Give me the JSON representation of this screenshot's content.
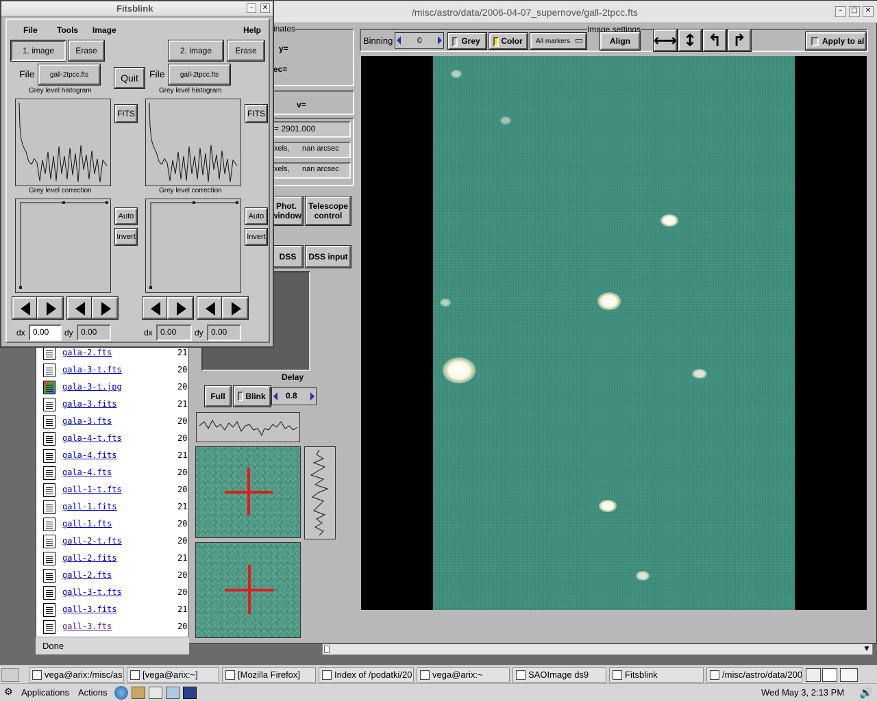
{
  "main_window": {
    "title": "/misc/astro/data/2006-04-07_supernove/gall-2tpcc.fts",
    "coords_group": "inates",
    "y_label": "y=",
    "dec_label": "ec=",
    "v_label": "v=",
    "value_field": "= 2901.000",
    "pixels_row1": "xels,      nan arcsec",
    "pixels_row2": "xels,      nan arcsec",
    "phot_button": "Phot.\nwindow",
    "telescope_button": "Telescope\ncontrol",
    "dss_button": "DSS",
    "dss_input_button": "DSS input",
    "delay_label": "Delay",
    "full_button": "Full",
    "blink_button": "Blink",
    "delay_value": "0.8",
    "image_settings_label": "Image settings",
    "binning_label": "Binning",
    "binning_value": "0",
    "grey_label": "Grey",
    "color_label": "Color",
    "markers_label": "All markers",
    "align_button": "Align",
    "apply_label": "Apply to all"
  },
  "fitsblink": {
    "title": "Fitsblink",
    "menu": [
      "File",
      "Tools",
      "Image",
      "Help"
    ],
    "image1_button": "1. image",
    "image2_button": "2. image",
    "erase_label": "Erase",
    "quit_button": "Quit",
    "file_label": "File",
    "file1": "gall-2tpcc.fts",
    "file2": "gall-2tpcc.fts",
    "histogram_label": "Grey level histogram",
    "correction_label": "Grey level correction",
    "fits_button": "FITS",
    "auto_button": "Auto",
    "invert_button": "Invert",
    "dx_label": "dx",
    "dy_label": "dy",
    "dx1": "0.00",
    "dy1": "0.00",
    "dx2": "0.00",
    "dy2": "0.00"
  },
  "browser": {
    "files": [
      {
        "name": "gala-2.fts",
        "size": "21"
      },
      {
        "name": "gala-3-t.fts",
        "size": "20"
      },
      {
        "name": "gala-3-t.jpg",
        "size": "20"
      },
      {
        "name": "gala-3.fits",
        "size": "21"
      },
      {
        "name": "gala-3.fts",
        "size": "20"
      },
      {
        "name": "gala-4-t.fts",
        "size": "20"
      },
      {
        "name": "gala-4.fits",
        "size": "21"
      },
      {
        "name": "gala-4.fts",
        "size": "20"
      },
      {
        "name": "gall-1-t.fts",
        "size": "20"
      },
      {
        "name": "gall-1.fits",
        "size": "21"
      },
      {
        "name": "gall-1.fts",
        "size": "20"
      },
      {
        "name": "gall-2-t.fts",
        "size": "20"
      },
      {
        "name": "gall-2.fits",
        "size": "21"
      },
      {
        "name": "gall-2.fts",
        "size": "20"
      },
      {
        "name": "gall-3-t.fts",
        "size": "20"
      },
      {
        "name": "gall-3.fits",
        "size": "21"
      },
      {
        "name": "gall-3.fts",
        "size": "20"
      }
    ],
    "status": "Done"
  },
  "taskbar": {
    "tasks": [
      "vega@arix:/misc/as",
      "[vega@arix:~]",
      "[Mozilla Firefox]",
      "Index of /podatki/20",
      "vega@arix:~",
      "SAOImage ds9",
      "Fitsblink",
      "/misc/astro/data/200"
    ]
  },
  "panel": {
    "applications": "Applications",
    "actions": "Actions",
    "clock": "Wed May  3,  2:13 PM"
  }
}
